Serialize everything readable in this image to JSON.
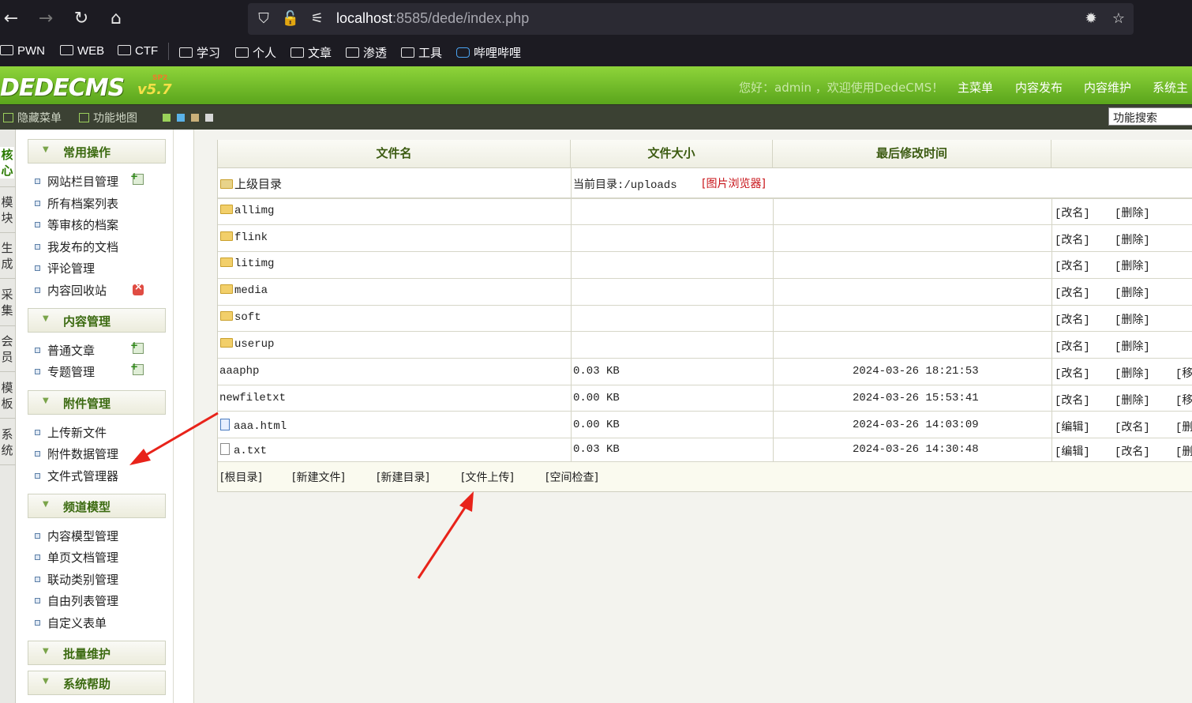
{
  "browser": {
    "url_host": "localhost",
    "url_rest": ":8585/dede/index.php",
    "bookmarks": [
      "PWN",
      "WEB",
      "CTF",
      "学习",
      "个人",
      "文章",
      "渗透",
      "工具",
      "哔哩哔哩"
    ]
  },
  "header": {
    "logo": "DEDECMS",
    "version": "v5.7",
    "edition": "SP2",
    "welcome": "您好：admin ，欢迎使用DedeCMS！",
    "menu": [
      "主菜单",
      "内容发布",
      "内容维护",
      "系统主"
    ]
  },
  "toolbar": {
    "hide_menu": "隐藏菜单",
    "function_map": "功能地图",
    "search_placeholder": "功能搜索",
    "skins": [
      "#9ad15a",
      "#5ab2e8",
      "#c9b07a",
      "#d7d7d7"
    ]
  },
  "left_tabs": [
    [
      "核",
      "心"
    ],
    [
      "模",
      "块"
    ],
    [
      "生",
      "成"
    ],
    [
      "采",
      "集"
    ],
    [
      "会",
      "员"
    ],
    [
      "模",
      "板"
    ],
    [
      "系",
      "统"
    ]
  ],
  "sidebar": {
    "groups": [
      {
        "title": "常用操作",
        "items": [
          "网站栏目管理",
          "所有档案列表",
          "等审核的档案",
          "我发布的文档",
          "评论管理",
          "内容回收站"
        ]
      },
      {
        "title": "内容管理",
        "items": [
          "普通文章",
          "专题管理"
        ]
      },
      {
        "title": "附件管理",
        "items": [
          "上传新文件",
          "附件数据管理",
          "文件式管理器"
        ]
      },
      {
        "title": "频道模型",
        "items": [
          "内容模型管理",
          "单页文档管理",
          "联动类别管理",
          "自由列表管理",
          "自定义表单"
        ]
      },
      {
        "title": "批量维护",
        "items": []
      },
      {
        "title": "系统帮助",
        "items": []
      }
    ]
  },
  "file_manager": {
    "columns": [
      "文件名",
      "文件大小",
      "最后修改时间",
      ""
    ],
    "parent_dir": "上级目录",
    "current_dir": "当前目录:/uploads",
    "image_browser": "[图片浏览器]",
    "rows": [
      {
        "name": "allimg",
        "type": "folder",
        "size": "",
        "mtime": "",
        "actions": [
          "[改名]",
          "[删除]",
          ""
        ]
      },
      {
        "name": "flink",
        "type": "folder",
        "size": "",
        "mtime": "",
        "actions": [
          "[改名]",
          "[删除]",
          ""
        ]
      },
      {
        "name": "litimg",
        "type": "folder",
        "size": "",
        "mtime": "",
        "actions": [
          "[改名]",
          "[删除]",
          ""
        ]
      },
      {
        "name": "media",
        "type": "folder",
        "size": "",
        "mtime": "",
        "actions": [
          "[改名]",
          "[删除]",
          ""
        ]
      },
      {
        "name": "soft",
        "type": "folder",
        "size": "",
        "mtime": "",
        "actions": [
          "[改名]",
          "[删除]",
          ""
        ]
      },
      {
        "name": "userup",
        "type": "folder",
        "size": "",
        "mtime": "",
        "actions": [
          "[改名]",
          "[删除]",
          ""
        ]
      },
      {
        "name": "aaaphp",
        "type": "plain",
        "size": "0.03 KB",
        "mtime": "2024-03-26 18:21:53",
        "actions": [
          "[改名]",
          "[删除]",
          "[移"
        ]
      },
      {
        "name": "newfiletxt",
        "type": "plain",
        "size": "0.00 KB",
        "mtime": "2024-03-26 15:53:41",
        "actions": [
          "[改名]",
          "[删除]",
          "[移"
        ]
      },
      {
        "name": "aaa.html",
        "type": "html",
        "size": "0.00 KB",
        "mtime": "2024-03-26 14:03:09",
        "actions": [
          "[编辑]",
          "[改名]",
          "[删"
        ]
      },
      {
        "name": "a.txt",
        "type": "txt",
        "size": "0.03 KB",
        "mtime": "2024-03-26 14:30:48",
        "actions": [
          "[编辑]",
          "[改名]",
          "[删"
        ]
      }
    ],
    "footer_links": [
      "[根目录]",
      "[新建文件]",
      "[新建目录]",
      "[文件上传]",
      "[空间检查]"
    ]
  }
}
